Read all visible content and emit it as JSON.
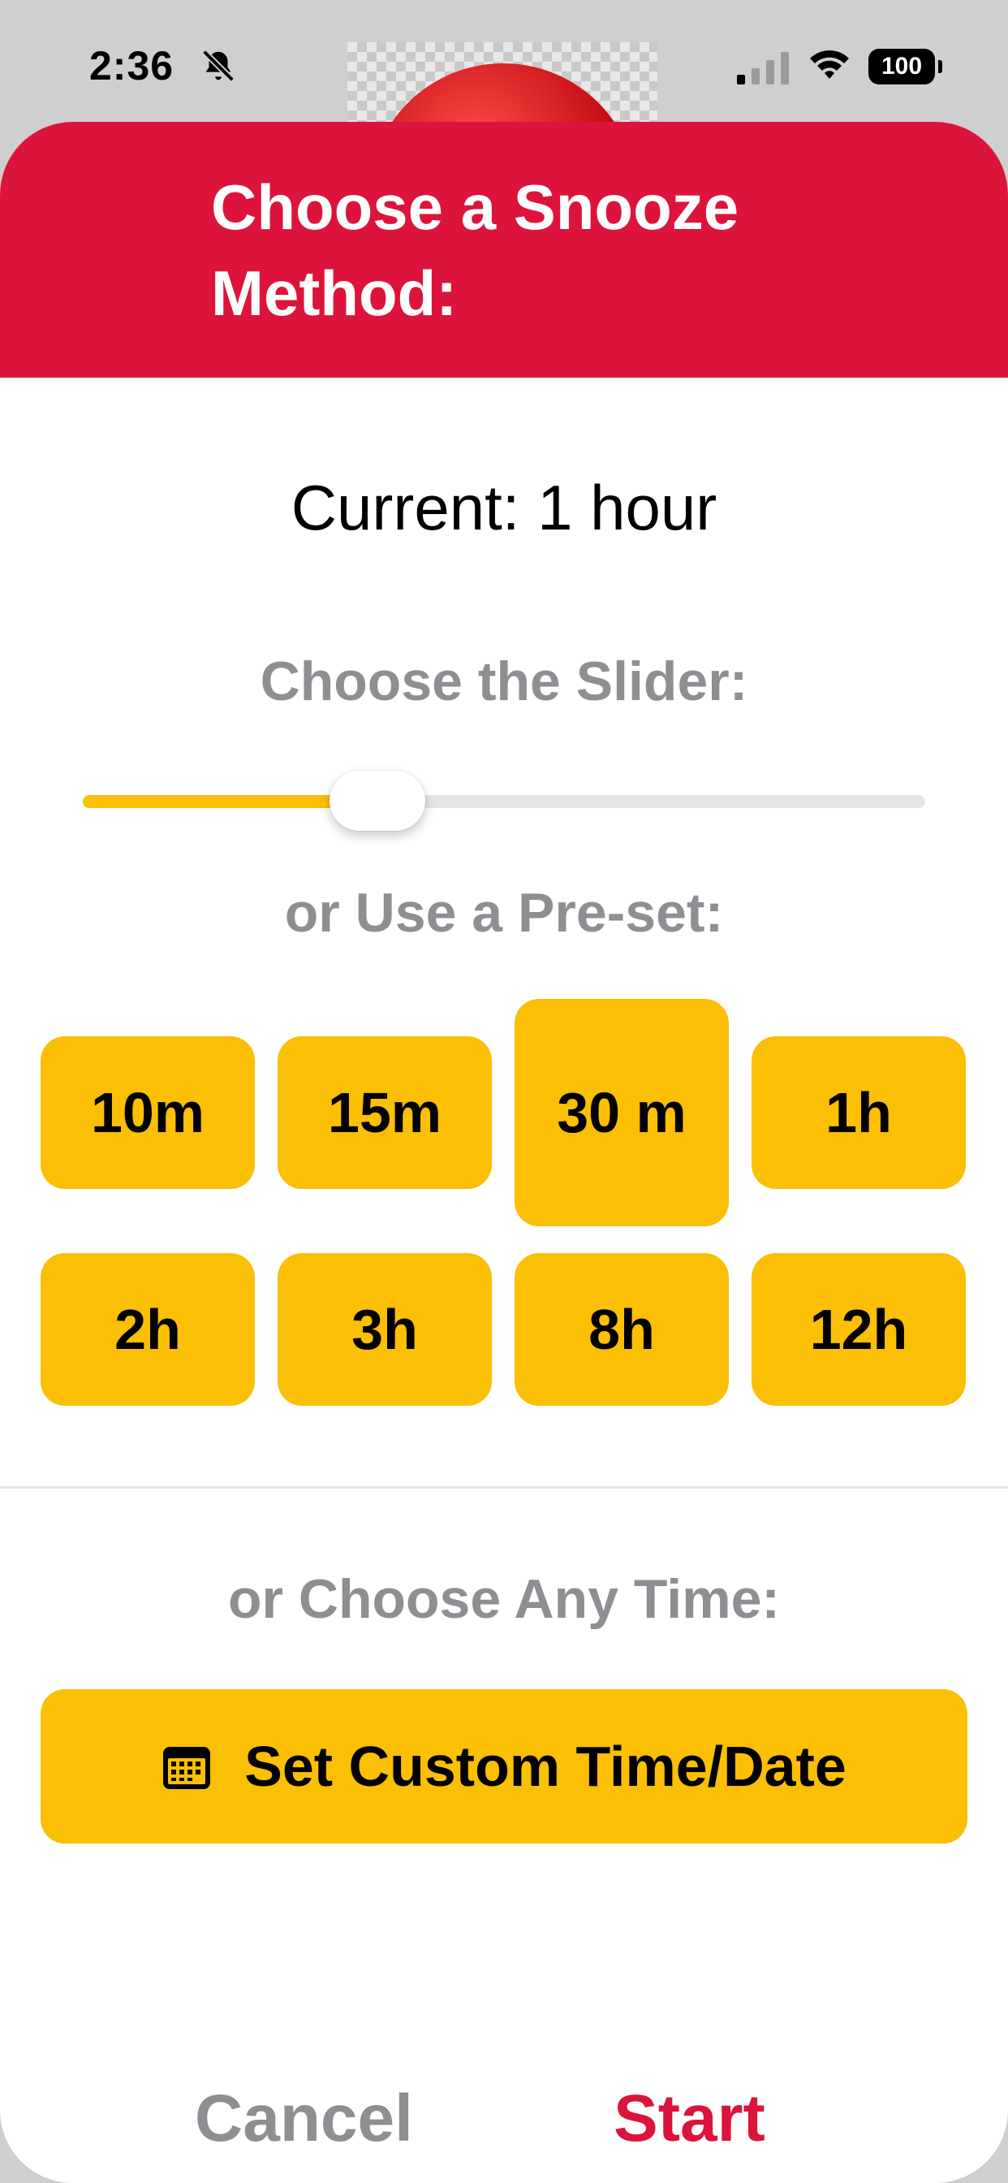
{
  "status_bar": {
    "time": "2:36",
    "battery": "100",
    "icons": [
      "bell-slash-icon",
      "cellular-signal-icon",
      "wifi-icon",
      "battery-icon"
    ]
  },
  "sheet": {
    "title": "Choose a Snooze Method:",
    "current": "Current: 1 hour",
    "slider_label": "Choose the Slider:",
    "slider_value": 0.35,
    "preset_label": "or Use a Pre-set:",
    "presets": [
      "10m",
      "15m",
      "30 m",
      "1h",
      "2h",
      "3h",
      "8h",
      "12h"
    ],
    "selected_preset": "30 m",
    "custom_label": "or Choose Any Time:",
    "custom_button": "Set Custom Time/Date",
    "custom_icon": "calendar-icon",
    "cancel": "Cancel",
    "start": "Start"
  },
  "colors": {
    "header": "#dc143c",
    "accent": "#fbbf05",
    "muted": "#8e8e93"
  }
}
